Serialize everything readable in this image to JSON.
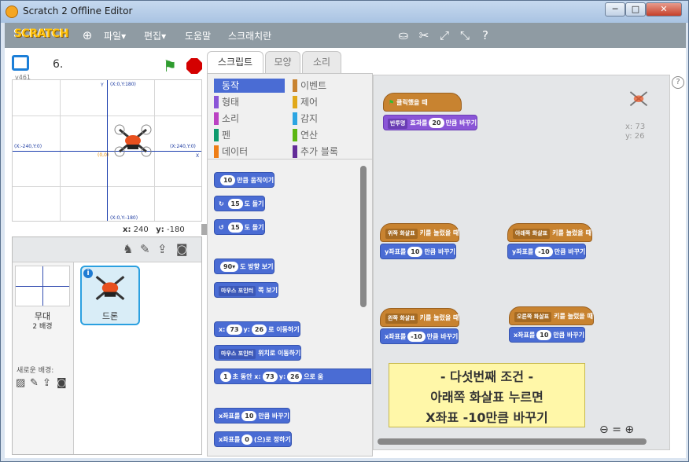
{
  "window": {
    "title": "Scratch 2 Offline Editor",
    "min": "─",
    "max": "□",
    "close": "✕"
  },
  "menubar": {
    "logo": "SCRATCH",
    "items": [
      "파일▾",
      "편집▾",
      "도움말",
      "스크래치란"
    ]
  },
  "stage": {
    "project": "6.",
    "version": "v461",
    "mouse_x_label": "x:",
    "mouse_x": "240",
    "mouse_y_label": "y:",
    "mouse_y": "-180",
    "coords": {
      "top": "(X:0,Y:180)",
      "left": "(X:-240,Y:0)",
      "right": "(X:240,Y:0)",
      "bottom": "(X:0,Y:-180)",
      "y": "Y",
      "x": "X",
      "o": "(0,0)"
    }
  },
  "sprites": {
    "stage_label": "무대",
    "stage_backdrops": "2 배경",
    "new_backdrop": "새로운 배경:",
    "sprite_name": "드론"
  },
  "tabs": [
    "스크립트",
    "모양",
    "소리"
  ],
  "categories": [
    {
      "label": "동작",
      "color": "#4a6cd4"
    },
    {
      "label": "형태",
      "color": "#8a55d7"
    },
    {
      "label": "소리",
      "color": "#bb42c3"
    },
    {
      "label": "펜",
      "color": "#0e9a6c"
    },
    {
      "label": "데이터",
      "color": "#ee7d16"
    },
    {
      "label": "이벤트",
      "color": "#c88330"
    },
    {
      "label": "제어",
      "color": "#e1a91a"
    },
    {
      "label": "감지",
      "color": "#2ca5e2"
    },
    {
      "label": "연산",
      "color": "#5cb712"
    },
    {
      "label": "추가 블록",
      "color": "#632d99"
    }
  ],
  "palette": {
    "move": {
      "n": "10",
      "t": "만큼 움직이기"
    },
    "turn_r": {
      "n": "15",
      "t": "도 돌기"
    },
    "turn_l": {
      "n": "15",
      "t": "도 돌기"
    },
    "point_dir": {
      "n": "90▾",
      "t": "도 방향 보기"
    },
    "point_to": {
      "d": "마우스 포인터",
      "t": "쪽 보기"
    },
    "goto_xy": {
      "x": "x:",
      "xv": "73",
      "y": "y:",
      "yv": "26",
      "t": "로 이동하기"
    },
    "goto": {
      "d": "마우스 포인터",
      "t": "위치로 이동하기"
    },
    "glide": {
      "n": "1",
      "t1": "초 동안 x:",
      "xv": "73",
      "t2": "y:",
      "yv": "26",
      "t3": "으로 움"
    },
    "change_x": {
      "t1": "x좌표를",
      "n": "10",
      "t2": "만큼 바꾸기"
    },
    "set_x": {
      "t1": "x좌표를",
      "n": "0",
      "t2": "(으)로 정하기"
    }
  },
  "scripts": {
    "flag_hat": "클릭했을 때",
    "effect": {
      "d": "반투명",
      "t1": "효과를",
      "n": "20",
      "t2": "만큼 바꾸기"
    },
    "up": {
      "d": "위쪽 화살표",
      "t": "키를 눌렀을 때",
      "cmd": "y좌표를",
      "n": "10",
      "t2": "만큼 바꾸기"
    },
    "down": {
      "d": "아래쪽 화살표",
      "t": "키를 눌렀을 때",
      "cmd": "y좌표를",
      "n": "-10",
      "t2": "만큼 바꾸기"
    },
    "left": {
      "d": "왼쪽 화살표",
      "t": "키를 눌렀을 때",
      "cmd": "x좌표를",
      "n": "-10",
      "t2": "만큼 바꾸기"
    },
    "right": {
      "d": "오른쪽 화살표",
      "t": "키를 눌렀을 때",
      "cmd": "x좌표를",
      "n": "10",
      "t2": "만큼 바꾸기"
    },
    "sprite_x": "x: 73",
    "sprite_y": "y: 26"
  },
  "note": [
    "- 다섯번째 조건 -",
    "아래쪽 화살표 누르면",
    "X좌표 -10만큼 바꾸기"
  ],
  "zoom": {
    "out": "🔍−",
    "reset": "=",
    "in": "🔍+"
  }
}
